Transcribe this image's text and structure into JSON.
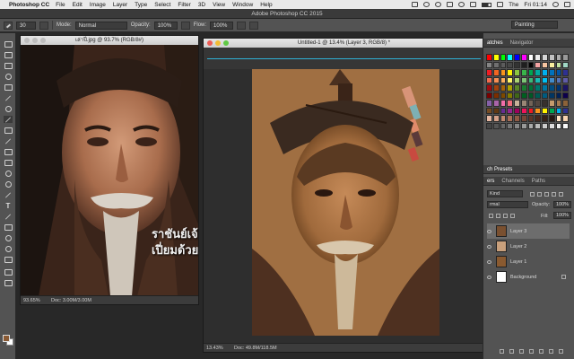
{
  "menubar": {
    "app": "Photoshop CC",
    "items": [
      "File",
      "Edit",
      "Image",
      "Layer",
      "Type",
      "Select",
      "Filter",
      "3D",
      "View",
      "Window",
      "Help"
    ],
    "user": "The",
    "clock": "Fri 01:14"
  },
  "window_title": "Adobe Photoshop CC 2015",
  "options": {
    "brush_size": "30",
    "mode_label": "Mode:",
    "mode_value": "Normal",
    "opacity_label": "Opacity:",
    "opacity_value": "100%",
    "flow_label": "Flow:",
    "flow_value": "100%",
    "workspace": "Painting"
  },
  "photo_doc": {
    "title": "เล่าปี่.jpg @ 93.7% (RGB/8#)",
    "zoom": "93.65%",
    "doc_info": "Doc: 3.00M/3.00M",
    "overlay_line1": "ราชันย์เจ้า",
    "overlay_line2": "เปี่ยมด้วยค"
  },
  "paint_doc": {
    "title": "Untitled-1 @ 13.4% (Layer 3, RGB/8) *",
    "zoom": "13.43%",
    "doc_info": "Doc: 49.8M/118.5M"
  },
  "panels": {
    "swatches_tabs": [
      "atches",
      "Navigator"
    ],
    "presets_tab": "ch Presets",
    "layers_tabs": [
      "ers",
      "Channels",
      "Paths"
    ],
    "kind_label": "Kind",
    "blend_mode": "rmal",
    "opacity_label": "Opacity:",
    "opacity_value": "100%",
    "fill_label": "Fill:",
    "fill_value": "100%",
    "layers": [
      {
        "name": "Layer 3",
        "selected": true,
        "thumb": "#7a5030"
      },
      {
        "name": "Layer 2",
        "selected": false,
        "thumb": "#c9a07c"
      },
      {
        "name": "Layer 1",
        "selected": false,
        "thumb": "#8a5a30"
      },
      {
        "name": "Background",
        "selected": false,
        "thumb": "#ffffff"
      }
    ]
  },
  "colors": {
    "foreground": "#8a5a34",
    "background": "#ffffff",
    "swatches": [
      "#ff0000",
      "#ffff00",
      "#00ff00",
      "#00ffff",
      "#0000ff",
      "#ff00ff",
      "#ffffff",
      "#ebebeb",
      "#d6d6d6",
      "#c2c2c2",
      "#adadad",
      "#999999",
      "#858585",
      "#707070",
      "#5c5c5c",
      "#474747",
      "#333333",
      "#1f1f1f",
      "#000000",
      "#f5a3a3",
      "#f7c5a0",
      "#fbf0a0",
      "#c2e3a0",
      "#a0d7c5",
      "#ee1d24",
      "#f26522",
      "#f7941d",
      "#fff200",
      "#8dc63f",
      "#39b54a",
      "#00a651",
      "#00a99d",
      "#00aeef",
      "#0072bc",
      "#0054a6",
      "#2e3192",
      "#f26c4f",
      "#f68e55",
      "#fbaf5c",
      "#fff568",
      "#acd372",
      "#7cc576",
      "#3bb878",
      "#1abbb4",
      "#00bff3",
      "#438ccb",
      "#5574b9",
      "#605ca8",
      "#9e0b0f",
      "#a0410d",
      "#a36209",
      "#aba000",
      "#598527",
      "#1a7b30",
      "#007236",
      "#00746b",
      "#0076a3",
      "#004b80",
      "#003471",
      "#1b1464",
      "#790000",
      "#7b2e00",
      "#7d4900",
      "#827b00",
      "#406618",
      "#005e20",
      "#005826",
      "#005952",
      "#005b7f",
      "#003663",
      "#002157",
      "#0d004c",
      "#8560a8",
      "#a864a8",
      "#f06ea9",
      "#f26d7d",
      "#c7b299",
      "#998675",
      "#736357",
      "#534741",
      "#37302d",
      "#c69c6d",
      "#a67c52",
      "#8c6239",
      "#754c24",
      "#603913",
      "#662d91",
      "#92278f",
      "#9e005d",
      "#ed145b",
      "#ed1c24",
      "#f7941d",
      "#fff200",
      "#00a651",
      "#00aeef",
      "#2e3192",
      "#e6b8a2",
      "#d4a088",
      "#c08870",
      "#a97058",
      "#8f5a44",
      "#754636",
      "#5c3528",
      "#46281e",
      "#352018",
      "#261812",
      "#ffe4c4",
      "#f5d2b0",
      "#444444",
      "#555555",
      "#666666",
      "#777777",
      "#888888",
      "#999999",
      "#aaaaaa",
      "#bbbbbb",
      "#cccccc",
      "#dddddd",
      "#eeeeee",
      "#fafafa"
    ]
  }
}
